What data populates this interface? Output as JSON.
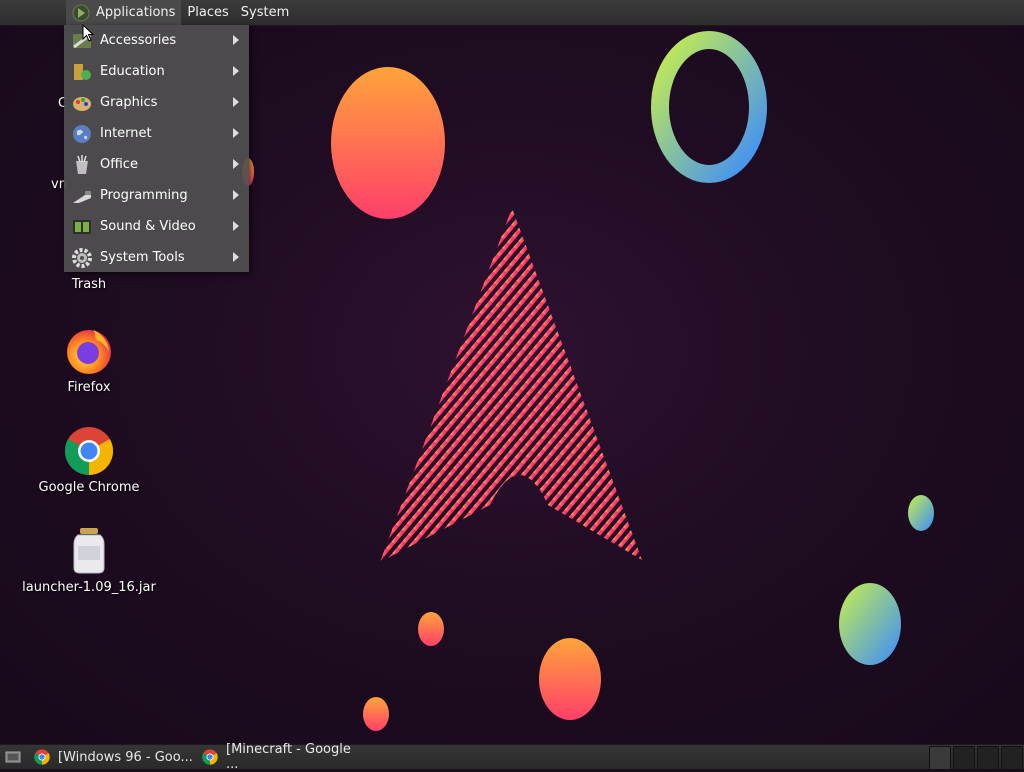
{
  "top_panel": {
    "applications_label": "Applications",
    "places_label": "Places",
    "system_label": "System"
  },
  "applications_menu": {
    "items": [
      {
        "label": "Accessories",
        "icon": "accessories-icon"
      },
      {
        "label": "Education",
        "icon": "education-icon"
      },
      {
        "label": "Graphics",
        "icon": "graphics-icon"
      },
      {
        "label": "Internet",
        "icon": "internet-globe-icon"
      },
      {
        "label": "Office",
        "icon": "office-icon"
      },
      {
        "label": "Programming",
        "icon": "programming-icon"
      },
      {
        "label": "Sound & Video",
        "icon": "sound-video-icon"
      },
      {
        "label": "System Tools",
        "icon": "system-tools-gear-icon"
      }
    ]
  },
  "desktop": {
    "partial_labels": [
      "C",
      "vn"
    ],
    "icons": [
      {
        "label": "Trash",
        "icon": "trash-icon"
      },
      {
        "label": "Firefox",
        "icon": "firefox-icon"
      },
      {
        "label": "Google Chrome",
        "icon": "chrome-icon"
      },
      {
        "label": "launcher-1.09_16.jar",
        "icon": "jar-file-icon"
      }
    ]
  },
  "taskbar": {
    "tasks": [
      {
        "label": "[Windows 96 - Goo...",
        "icon": "chrome-icon"
      },
      {
        "label": "[Minecraft - Google ...",
        "icon": "chrome-icon"
      }
    ]
  },
  "colors": {
    "panel": "#2d2d2d",
    "menu_bg": "#505050",
    "wallpaper": "#1f0c22"
  }
}
